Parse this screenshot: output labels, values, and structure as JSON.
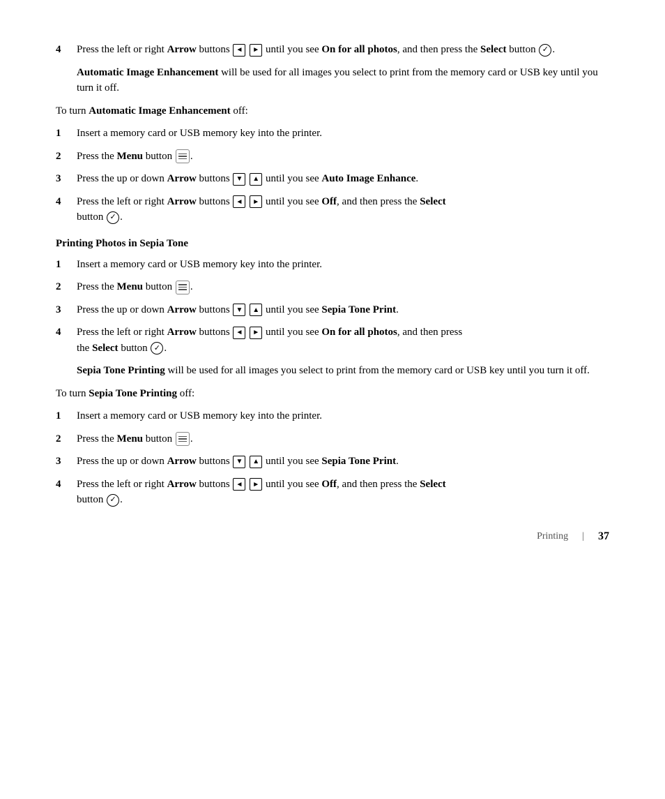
{
  "page": {
    "step4_top": {
      "number": "4",
      "text_before_arrow": "Press the left or right ",
      "arrow_label": "Arrow",
      "text_after_arrow": " buttons",
      "text_until": " until you see ",
      "on_for_all": "On for all photos",
      "text_then": ", and then press the ",
      "select_bold": "Select",
      "text_button": " button",
      "select_icon": "✓"
    },
    "note1": {
      "bold_part": "Automatic Image Enhancement",
      "rest": " will be used for all images you select to print from the memory card or USB key until you turn it off."
    },
    "to_turn1": {
      "text_before": "To turn ",
      "bold_part": "Automatic Image Enhancement",
      "text_after": " off:"
    },
    "section1_items": [
      {
        "number": "1",
        "text": "Insert a memory card or USB memory key into the printer."
      },
      {
        "number": "2",
        "text_before": "Press the ",
        "bold": "Menu",
        "text_after": " button"
      },
      {
        "number": "3",
        "text_before": "Press the up or down ",
        "bold": "Arrow",
        "text_after": " buttons",
        "text_until": " until you see ",
        "bold2": "Auto Image Enhance",
        "text_end": "."
      },
      {
        "number": "4",
        "text_before": "Press the left or right ",
        "bold": "Arrow",
        "text_after": " buttons",
        "text_until": " until you see ",
        "bold2": "Off",
        "text_then": ", and then press the ",
        "bold3": "Select",
        "text_button": "\n      button"
      }
    ],
    "section2_heading": "Printing Photos in Sepia Tone",
    "section2_items": [
      {
        "number": "1",
        "text": "Insert a memory card or USB memory key into the printer."
      },
      {
        "number": "2",
        "text_before": "Press the ",
        "bold": "Menu",
        "text_after": " button"
      },
      {
        "number": "3",
        "text_before": "Press the up or down ",
        "bold": "Arrow",
        "text_after": " buttons",
        "text_until": " until you see ",
        "bold2": "Sepia Tone Print",
        "text_end": "."
      },
      {
        "number": "4",
        "text_before": "Press the left or right ",
        "bold": "Arrow",
        "text_after": " buttons",
        "text_until": " until you see ",
        "bold2": "On for all photos",
        "text_then": ", and then press the ",
        "bold3": "Select",
        "text_button": "\n      button"
      }
    ],
    "note2": {
      "bold_part": "Sepia Tone Printing",
      "rest": " will be used for all images you select to print from the memory card or USB key until you turn it off."
    },
    "to_turn2": {
      "text_before": "To turn ",
      "bold_part": "Sepia Tone Printing",
      "text_after": " off:"
    },
    "section3_items": [
      {
        "number": "1",
        "text": "Insert a memory card or USB memory key into the printer."
      },
      {
        "number": "2",
        "text_before": "Press the ",
        "bold": "Menu",
        "text_after": " button"
      },
      {
        "number": "3",
        "text_before": "Press the up or down ",
        "bold": "Arrow",
        "text_after": " buttons",
        "text_until": " until you see ",
        "bold2": "Sepia Tone Print",
        "text_end": "."
      },
      {
        "number": "4",
        "text_before": "Press the left or right ",
        "bold": "Arrow",
        "text_after": " buttons",
        "text_until": " until you see ",
        "bold2": "Off",
        "text_then": ", and then press the ",
        "bold3": "Select",
        "text_button": "\n      button"
      }
    ],
    "footer": {
      "label": "Printing",
      "divider": "|",
      "page": "37"
    }
  }
}
